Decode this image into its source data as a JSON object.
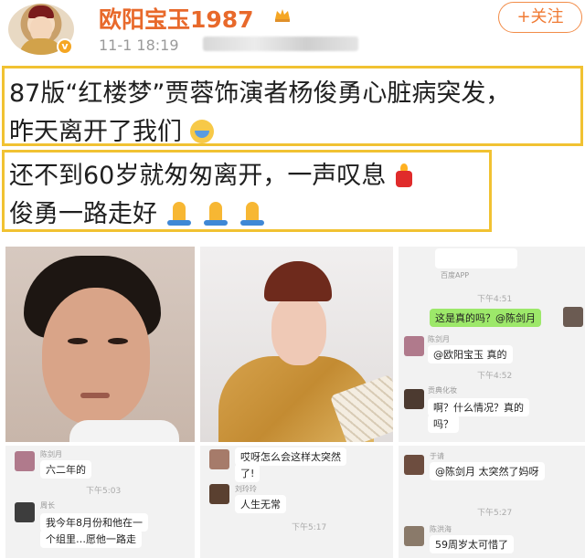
{
  "header": {
    "username": "欧阳宝玉1987",
    "timestamp": "11-1 18:19",
    "follow_label": "+关注"
  },
  "post": {
    "line1": "87版“红楼梦”贾蓉饰演者杨俊勇心脏病突发，",
    "line2": "昨天离开了我们",
    "line3": "还不到60岁就匆匆离开，一声叹息",
    "line4": "俊勇一路走好"
  },
  "chats": {
    "c3": {
      "app": "百度APP",
      "time1": "下午4:51",
      "msg1": "这是真的吗？@陈剑月",
      "name1": "陈剑月",
      "msg2": "@欧阳宝玉 真的",
      "time2": "下午4:52",
      "name2": "贡典化妆",
      "msg3a": "啊？什么情况？真的",
      "msg3b": "吗？"
    },
    "c4": {
      "name1": "陈剑月",
      "msg1": "六二年的",
      "time": "下午5:03",
      "name2": "周长",
      "msg2a": "我今年8月份和他在一",
      "msg2b": "个组里…愿他一路走"
    },
    "c5": {
      "msg1a": "哎呀怎么会这样太突然",
      "msg1b": "了!",
      "name1": "刘玲玲",
      "msg2": "人生无常",
      "time": "下午5:17"
    },
    "c6": {
      "name1": "于请",
      "msg1a": "@陈剑月 太突然了妈呀",
      "time": "下午5:27",
      "name2": "陈洪海",
      "msg2": "59周岁太可惜了"
    }
  },
  "colors": {
    "brand_orange": "#e8692b",
    "highlight_border": "#f1c232",
    "chat_green": "#9de86a"
  }
}
